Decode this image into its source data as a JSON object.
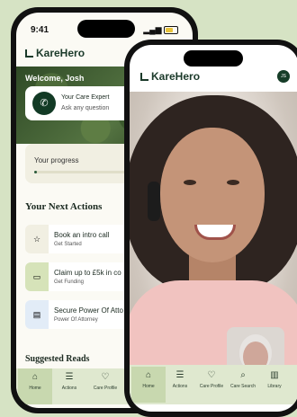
{
  "status": {
    "time": "9:41"
  },
  "brand": {
    "name": "KareHero"
  },
  "phone1": {
    "welcome": "Welcome, Josh",
    "expert": {
      "title": "Your Care Expert",
      "subtitle": "Ask any question",
      "icon": "phone-icon"
    },
    "progress": {
      "label": "Your progress",
      "fraction": 0.02
    },
    "next_actions_title": "Your Next Actions",
    "actions": [
      {
        "title": "Book an intro call",
        "subtitle": "Get Started",
        "icon": "star-icon",
        "color": "#f1efe2"
      },
      {
        "title": "Claim up to £5k in co",
        "subtitle": "Get Funding",
        "icon": "money-icon",
        "color": "#d6e3b9"
      },
      {
        "title": "Secure Power Of Atto",
        "subtitle": "Power Of Attorney",
        "icon": "document-icon",
        "color": "#e2ecf7"
      }
    ],
    "suggested_title": "Suggested Reads",
    "nav": [
      {
        "label": "Home",
        "icon": "home-icon"
      },
      {
        "label": "Actions",
        "icon": "checklist-icon"
      },
      {
        "label": "Care Profile",
        "icon": "care-profile-icon"
      }
    ]
  },
  "phone2": {
    "avatar_initials": "JS",
    "nav": [
      {
        "label": "Home",
        "icon": "home-icon"
      },
      {
        "label": "Actions",
        "icon": "checklist-icon"
      },
      {
        "label": "Care Profile",
        "icon": "care-profile-icon"
      },
      {
        "label": "Care Search",
        "icon": "search-icon"
      },
      {
        "label": "Library",
        "icon": "book-icon"
      }
    ]
  },
  "colors": {
    "brand_dark": "#123a25",
    "accent_green": "#dfe8cf",
    "background": "#d6e3c4"
  }
}
